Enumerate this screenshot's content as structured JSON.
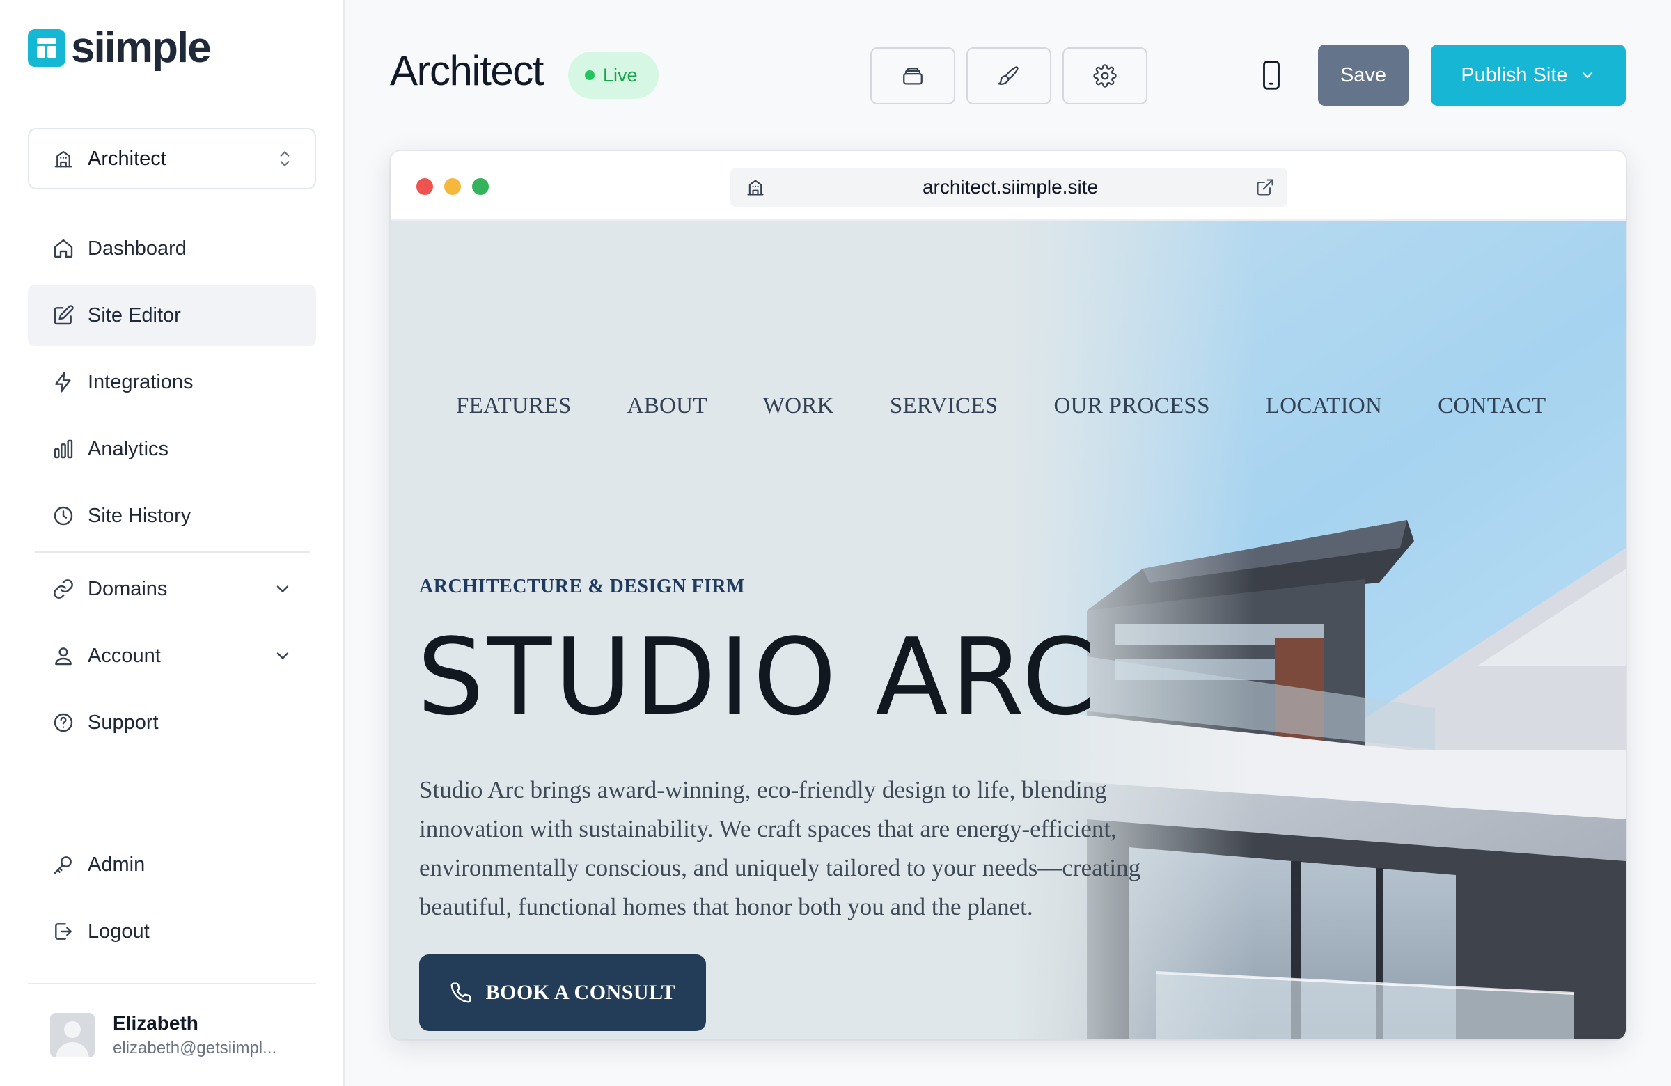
{
  "app": {
    "name": "siimple"
  },
  "sidebar": {
    "site_selector": {
      "label": "Architect"
    },
    "nav": [
      {
        "label": "Dashboard",
        "icon": "home-icon"
      },
      {
        "label": "Site Editor",
        "icon": "edit-icon",
        "active": true
      },
      {
        "label": "Integrations",
        "icon": "lightning-icon"
      },
      {
        "label": "Analytics",
        "icon": "bar-chart-icon"
      },
      {
        "label": "Site History",
        "icon": "clock-icon"
      }
    ],
    "nav_expandable": [
      {
        "label": "Domains",
        "icon": "link-icon"
      },
      {
        "label": "Account",
        "icon": "user-icon"
      }
    ],
    "support": {
      "label": "Support",
      "icon": "help-circle-icon"
    },
    "admin": {
      "label": "Admin",
      "icon": "key-icon"
    },
    "logout": {
      "label": "Logout",
      "icon": "logout-icon"
    },
    "user": {
      "name": "Elizabeth",
      "email": "elizabeth@getsiimpl..."
    }
  },
  "header": {
    "title": "Architect",
    "status": "Live",
    "tools": [
      "layers-icon",
      "brush-icon",
      "gear-icon"
    ],
    "device_icon": "mobile-icon",
    "save_label": "Save",
    "publish_label": "Publish Site"
  },
  "preview": {
    "url": "architect.siimple.site",
    "site": {
      "nav": [
        "FEATURES",
        "ABOUT",
        "WORK",
        "SERVICES",
        "OUR PROCESS",
        "LOCATION",
        "CONTACT"
      ],
      "eyebrow": "ARCHITECTURE & DESIGN FIRM",
      "title": "STUDIO ARC",
      "description": "Studio Arc brings award-winning, eco-friendly design to life, blending innovation with sustainability. We craft spaces that are energy-efficient, environmentally conscious, and uniquely tailored to your needs—creating beautiful, functional homes that honor both you and the planet.",
      "cta_label": "BOOK A CONSULT"
    }
  },
  "colors": {
    "brand": "#16b6d4",
    "save": "#64748b",
    "live_bg": "#d7f7e5",
    "live_text": "#16a34a",
    "cta": "#233d58"
  }
}
